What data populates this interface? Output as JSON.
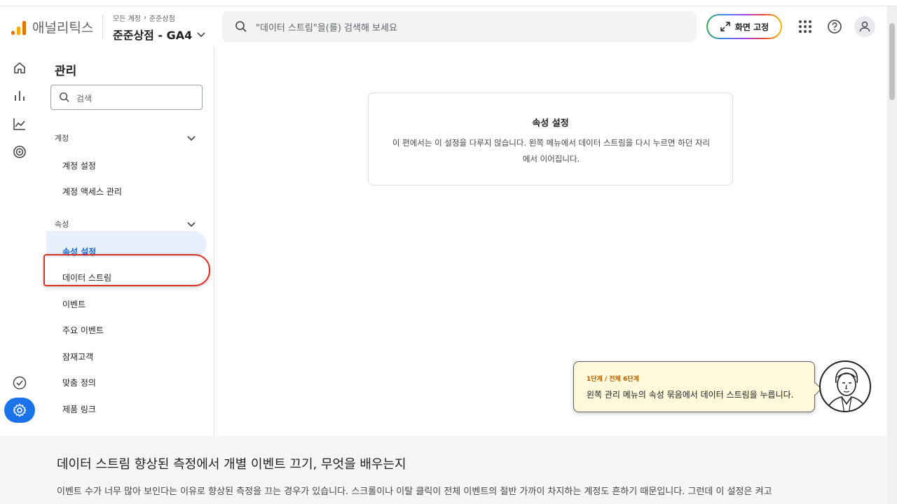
{
  "header": {
    "app_name": "애널리틱스",
    "breadcrumb": [
      "모든 계정",
      "준준상점"
    ],
    "property_name": "준준상점 - GA4",
    "search_placeholder": "\"데이터 스트림\"을(를) 검색해 보세요",
    "fix_screen_label": "화면 고정"
  },
  "sidenav": {
    "title": "관리",
    "search_placeholder": "검색",
    "sections": [
      {
        "label": "계정",
        "items": [
          "계정 설정",
          "계정 액세스 관리"
        ]
      },
      {
        "label": "속성",
        "items": [
          "속성 설정",
          "데이터 스트림",
          "이벤트",
          "주요 이벤트",
          "잠재고객",
          "맞춤 정의",
          "제품 링크"
        ]
      }
    ],
    "active_item": "속성 설정",
    "highlighted_item": "데이터 스트림"
  },
  "main": {
    "card_title": "속성 설정",
    "card_body": "이 편에서는 이 설정을 다루지 않습니다. 왼쪽 메뉴에서 데이터 스트림을 다시 누르면 하던 자리에서 이어집니다."
  },
  "tooltip": {
    "step": "1단계 / 전체 6단계",
    "text": "왼쪽 관리 메뉴의 속성 묶음에서 데이터 스트림을 누릅니다."
  },
  "article": {
    "title": "데이터 스트림 향상된 측정에서 개별 이벤트 끄기, 무엇을 배우는지",
    "body": "이벤트 수가 너무 많아 보인다는 이유로 향상된 측정을 끄는 경우가 있습니다. 스크롤이나 이탈 클릭이 전체 이벤트의 절반 가까이 차지하는 계정도 흔하기 때문입니다. 그런데 이 설정은 켜고"
  },
  "colors": {
    "accent": "#1a73e8",
    "highlight_border": "#d93025",
    "tooltip_bg": "#fff8db"
  },
  "icons": [
    "home-icon",
    "reports-icon",
    "explore-icon",
    "advertising-icon",
    "checkmark-icon",
    "settings-icon",
    "search-icon",
    "expand-icon",
    "apps-icon",
    "help-icon",
    "account-icon",
    "chevron-down-icon"
  ]
}
